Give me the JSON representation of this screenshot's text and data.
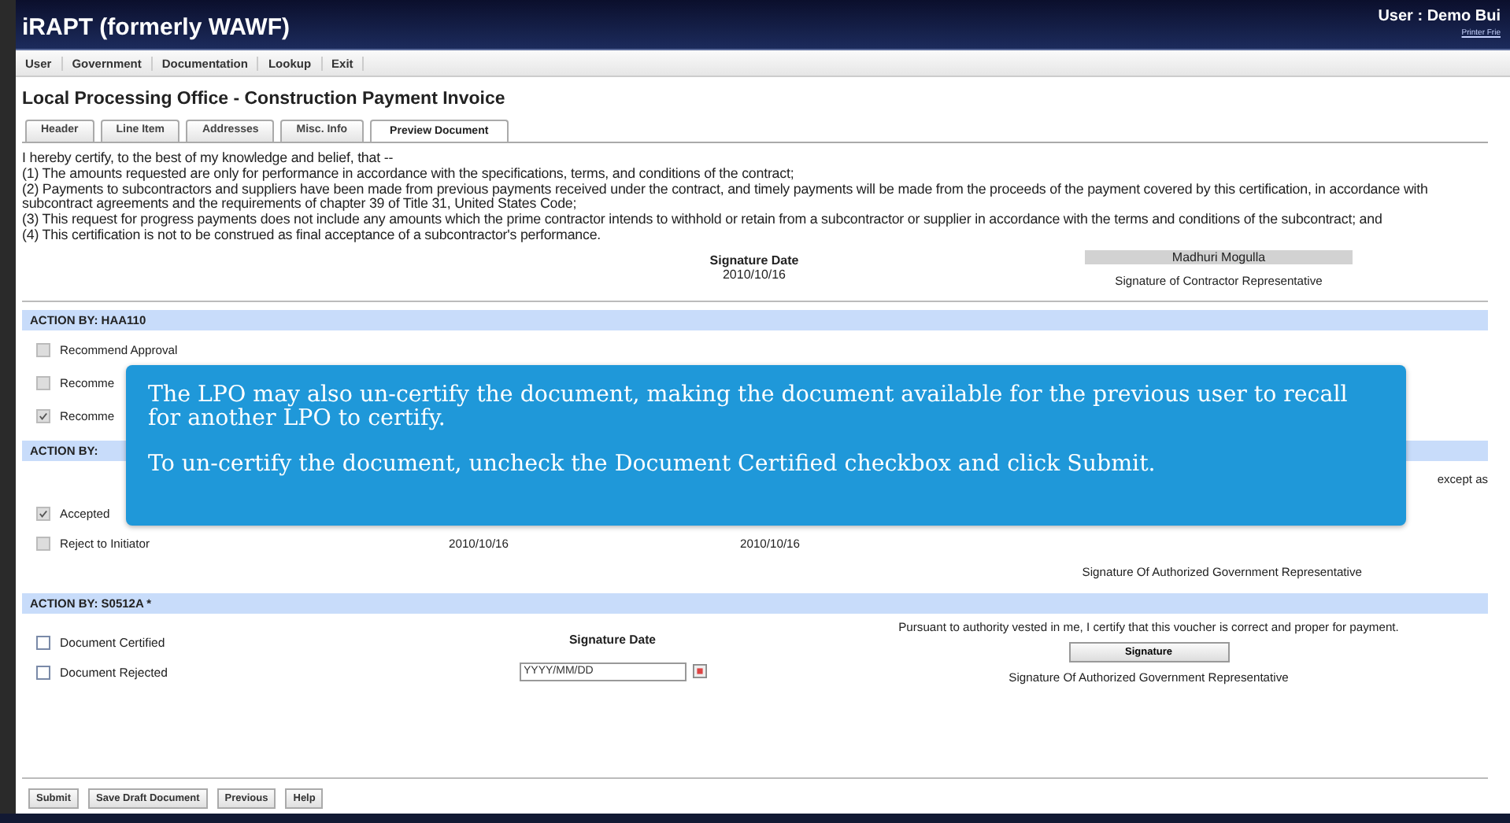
{
  "header": {
    "title": "iRAPT (formerly WAWF)",
    "user": "User : Demo Bui",
    "printer_link": "Printer Frie"
  },
  "menu": [
    "User",
    "Government",
    "Documentation",
    "Lookup",
    "Exit"
  ],
  "page_title": "Local Processing Office - Construction Payment Invoice",
  "tabs": [
    {
      "label": "Header",
      "selected": false
    },
    {
      "label": "Line Item",
      "selected": false
    },
    {
      "label": "Addresses",
      "selected": false
    },
    {
      "label": "Misc. Info",
      "selected": false
    },
    {
      "label": "Preview Document",
      "selected": true
    }
  ],
  "certification": [
    "I hereby certify, to the best of my knowledge and belief, that --",
    "(1) The amounts requested are only for performance in accordance with the specifications, terms, and conditions of the contract;",
    "(2) Payments to subcontractors and suppliers have been made from previous payments received under the contract, and timely payments will be made from the proceeds of the payment covered by this certification, in accordance with",
    "subcontract agreements and the requirements of chapter 39 of Title 31, United States Code;",
    "(3) This request for progress payments does not include any amounts which the prime contractor intends to withhold or retain from a subcontractor or supplier in accordance with the terms and conditions of the subcontract; and",
    "(4) This certification is not to be construed as final acceptance of a subcontractor's performance."
  ],
  "contractor_signature": {
    "date_label": "Signature Date",
    "date": "2010/10/16",
    "name": "Madhuri Mogulla",
    "caption": "Signature of Contractor Representative"
  },
  "sections": [
    {
      "kind": "review",
      "heading": "ACTION BY: HAA110",
      "rows": [
        {
          "label": "Recommend Approval",
          "checked": false,
          "disabled": true
        },
        {
          "label": "Recomme",
          "checked": false,
          "disabled": true
        },
        {
          "label": "Recomme",
          "checked": true,
          "disabled": true
        }
      ]
    },
    {
      "kind": "acceptance",
      "heading": "ACTION BY:",
      "note": "except as",
      "rows": [
        {
          "label": "Accepted",
          "checked": true,
          "disabled": true
        },
        {
          "label": "Reject to Initiator",
          "checked": false,
          "disabled": true,
          "dates": [
            "2010/10/16",
            "2010/10/16"
          ]
        }
      ],
      "caption": "Signature Of Authorized Government Representative"
    },
    {
      "kind": "certify",
      "heading": "ACTION BY: S0512A *",
      "rows": [
        {
          "label": "Document Certified",
          "checked": false,
          "disabled": false
        },
        {
          "label": "Document Rejected",
          "checked": false,
          "disabled": false
        }
      ],
      "date_label": "Signature Date",
      "date_placeholder": "YYYY/MM/DD",
      "statement": "Pursuant to authority vested in me, I certify that this voucher is correct and proper for payment.",
      "signature_button": "Signature",
      "caption": "Signature Of Authorized Government Representative"
    }
  ],
  "buttons": [
    "Submit",
    "Save Draft Document",
    "Previous",
    "Help"
  ],
  "callout": [
    "The LPO may also un-certify the document, making the document available for the previous user to recall for another LPO to certify.",
    "To un-certify the document, uncheck the Document Certified checkbox and click Submit."
  ]
}
